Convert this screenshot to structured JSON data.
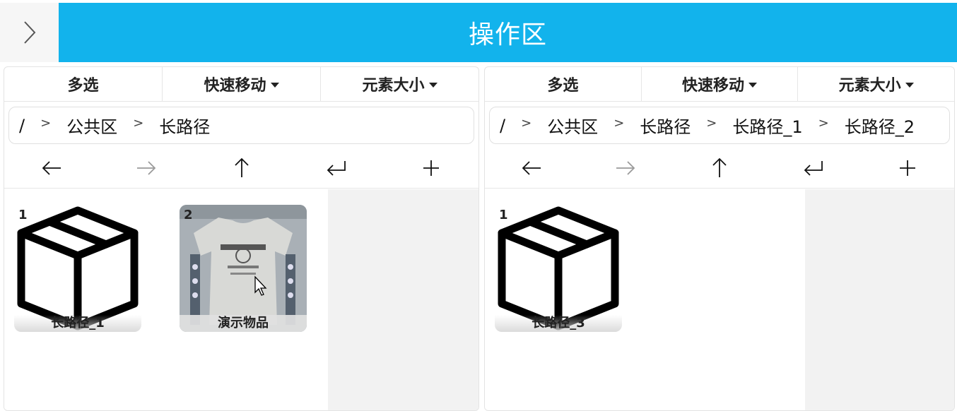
{
  "header": {
    "title": "操作区"
  },
  "panels": [
    {
      "toolbar": {
        "multi_select": "多选",
        "quick_move": "快速移动",
        "element_size": "元素大小"
      },
      "breadcrumb": [
        "/",
        "公共区",
        "长路径"
      ],
      "items": [
        {
          "index": "1",
          "label": "长路径_1",
          "type": "folder"
        },
        {
          "index": "2",
          "label": "演示物品",
          "type": "photo"
        }
      ]
    },
    {
      "toolbar": {
        "multi_select": "多选",
        "quick_move": "快速移动",
        "element_size": "元素大小"
      },
      "breadcrumb": [
        "/",
        "公共区",
        "长路径",
        "长路径_1",
        "长路径_2"
      ],
      "items": [
        {
          "index": "1",
          "label": "长路径_3",
          "type": "folder"
        }
      ]
    }
  ],
  "separator": ">",
  "icons": {
    "toggle": "chevron-right-icon",
    "back": "arrow-left-icon",
    "forward": "arrow-right-icon",
    "up": "arrow-up-icon",
    "enter": "enter-icon",
    "add": "plus-icon",
    "folder": "box-icon"
  },
  "colors": {
    "header_bg": "#12b3ec",
    "empty_area": "#f2f2f2",
    "forward_disabled": "#9a9a9a"
  }
}
